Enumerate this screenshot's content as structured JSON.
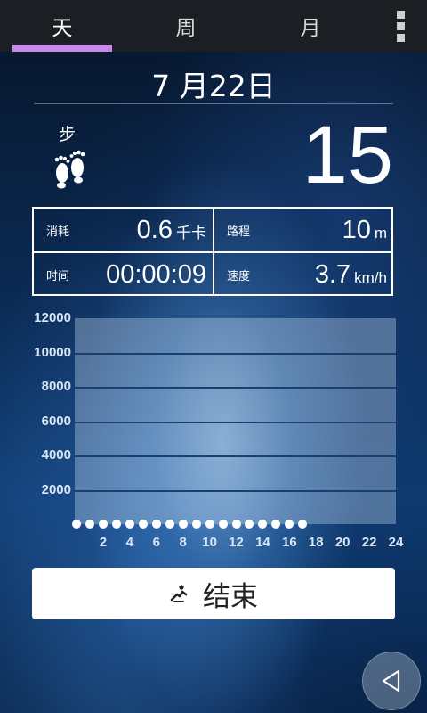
{
  "tabs": [
    {
      "label": "天",
      "active": true
    },
    {
      "label": "周",
      "active": false
    },
    {
      "label": "月",
      "active": false
    }
  ],
  "menu_icon": "overflow-menu-icon",
  "date": "7 月22日",
  "steps": {
    "label": "步",
    "icon": "footprints-icon",
    "value": "15"
  },
  "stats": {
    "calories": {
      "label": "消耗",
      "value": "0.6",
      "unit": "千卡"
    },
    "distance": {
      "label": "路程",
      "value": "10",
      "unit": "m"
    },
    "time": {
      "label": "时间",
      "value": "00:00:09"
    },
    "speed": {
      "label": "速度",
      "value": "3.7",
      "unit": "km/h"
    }
  },
  "chart_data": {
    "type": "line",
    "x": [
      0,
      1,
      2,
      3,
      4,
      5,
      6,
      7,
      8,
      9,
      10,
      11,
      12,
      13,
      14,
      15,
      16,
      17
    ],
    "values": [
      0,
      0,
      0,
      0,
      0,
      0,
      0,
      0,
      0,
      0,
      0,
      0,
      0,
      0,
      0,
      0,
      0,
      0
    ],
    "yticks": [
      "12000",
      "10000",
      "8000",
      "6000",
      "4000",
      "2000"
    ],
    "xticks": [
      "2",
      "4",
      "6",
      "8",
      "10",
      "12",
      "14",
      "16",
      "18",
      "20",
      "22",
      "24"
    ],
    "ylim": [
      0,
      12000
    ],
    "xlim": [
      0,
      24
    ],
    "grid": true,
    "colors": {
      "area": "#cde1f5",
      "grid": "#1a3e6e",
      "points": "#ffffff"
    }
  },
  "end_button": {
    "label": "结束",
    "icon": "runner-icon"
  },
  "nav": {
    "back_icon": "back-triangle-icon"
  }
}
